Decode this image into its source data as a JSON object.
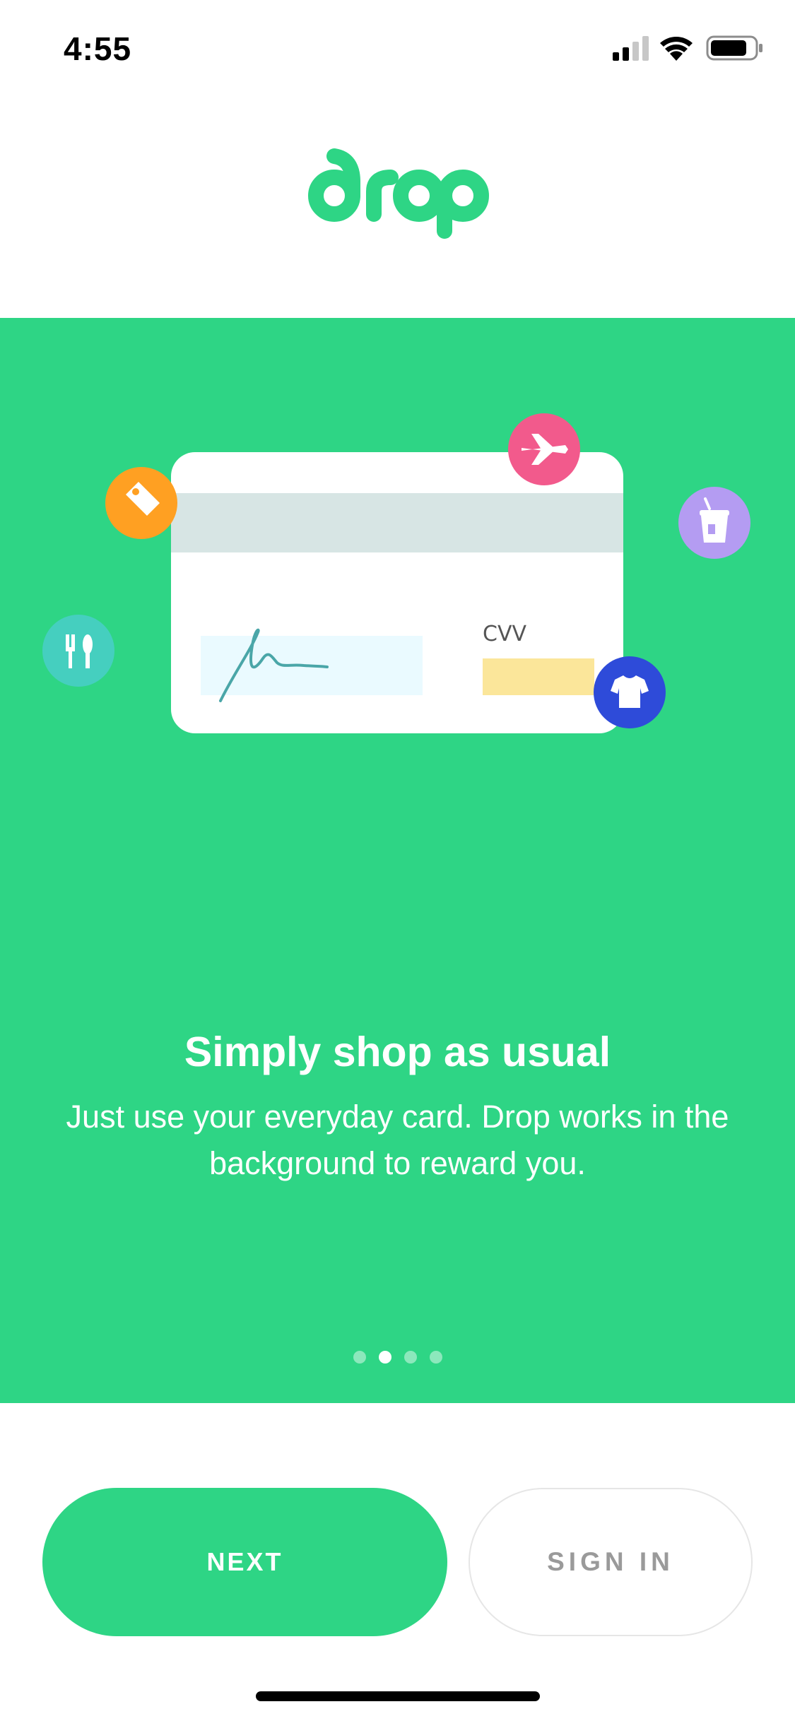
{
  "status_bar": {
    "time": "4:55",
    "icons": [
      "cellular-signal-icon",
      "wifi-icon",
      "battery-icon"
    ]
  },
  "brand": {
    "logo_text": "drop",
    "accent_color": "#2ed585"
  },
  "onboarding": {
    "illustration": {
      "card_label": "CVV",
      "icons": [
        "tag-icon",
        "airplane-icon",
        "cup-icon",
        "fork-knife-icon",
        "tshirt-icon"
      ]
    },
    "title": "Simply shop as usual",
    "body": "Just use your everyday card. Drop works in the background to reward you.",
    "pagination": {
      "total": 4,
      "active_index": 1
    }
  },
  "actions": {
    "next_label": "NEXT",
    "signin_label": "SIGN IN"
  }
}
